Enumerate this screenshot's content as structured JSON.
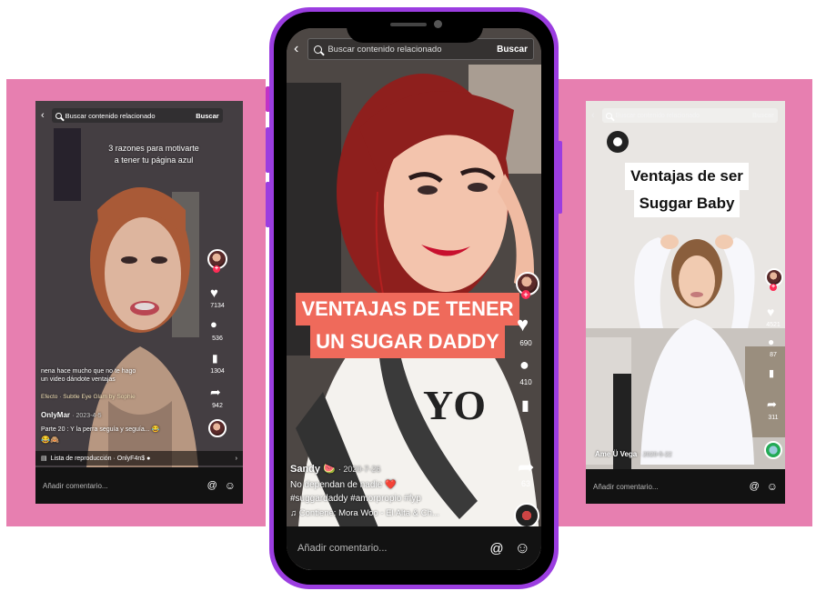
{
  "colors": {
    "pink": "#e77fb0",
    "phone_frame": "#9b3de0",
    "tiktok_red": "#fe2c55"
  },
  "left": {
    "search_placeholder": "Buscar contenido relacionado",
    "search_button": "Buscar",
    "overlay_line1": "3 razones para motivarte",
    "overlay_line2": "a tener tu página azul",
    "likes": "7134",
    "comments": "536",
    "saves": "1304",
    "shares": "942",
    "desc_line1": "nena hace mucho que no te hago",
    "desc_line2": "un video dándote ventajas",
    "effect": "Efecto · Subtle Eye Glam by Sophie",
    "username": "OnlyMar",
    "date": "· 2023-4-5",
    "part": "Parte 20 : Y la perra seguía y seguía... 😂",
    "emoji": "😂🙈",
    "playlist": "Lista de reproducción · OnlyF4n$ ●",
    "comment_placeholder": "Añadir comentario...",
    "at_icon": "@",
    "emoji_icon": "☺"
  },
  "center": {
    "search_placeholder": "Buscar contenido relacionado",
    "search_button": "Buscar",
    "overlay_line1": "VENTAJAS DE TENER",
    "overlay_line2": "UN SUGAR DADDY",
    "likes": "690",
    "comments": "410",
    "shares": "63",
    "username": "Sandy 🍉",
    "date": "· 2020-7-26",
    "desc": "No dependan de nadie ❤️",
    "hashtags": "#suggardaddy #amorpropio #fyp",
    "music": "♫ Contiene: Mora Woo - El Alta & Ch...",
    "comment_placeholder": "Añadir comentario...",
    "at_icon": "@",
    "emoji_icon": "☺"
  },
  "right": {
    "search_placeholder": "Buscar contenido relacionado",
    "search_button": "Buscar",
    "overlay_line1": "Ventajas de ser",
    "overlay_line2": "Suggar Baby",
    "likes": "4521",
    "comments": "87",
    "shares": "311",
    "username": "Ame Ü Vega",
    "date": "· 2020-5-22",
    "comment_placeholder": "Añadir comentario...",
    "at_icon": "@",
    "emoji_icon": "☺"
  }
}
